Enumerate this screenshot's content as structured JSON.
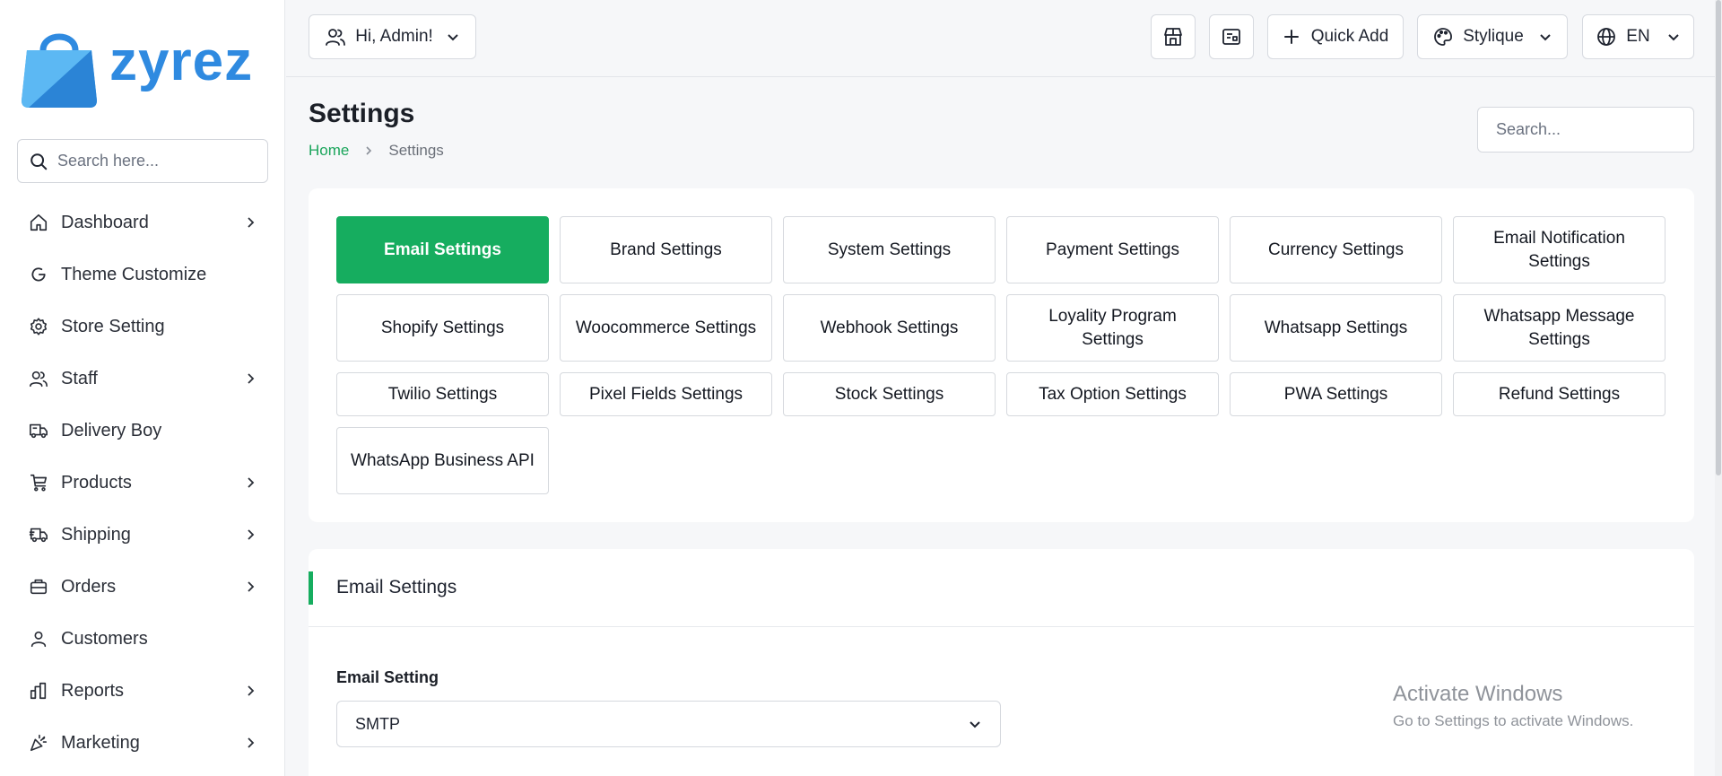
{
  "app": {
    "logo_text": "zyrez",
    "brand_color": "#2f8ae0",
    "accent_color": "#16ad5f"
  },
  "sidebar": {
    "search_placeholder": "Search here...",
    "items": [
      {
        "label": "Dashboard",
        "icon": "home-icon",
        "has_submenu": true
      },
      {
        "label": "Theme Customize",
        "icon": "theme-icon",
        "has_submenu": false
      },
      {
        "label": "Store Setting",
        "icon": "gear-icon",
        "has_submenu": false
      },
      {
        "label": "Staff",
        "icon": "users-icon",
        "has_submenu": true
      },
      {
        "label": "Delivery Boy",
        "icon": "truck-icon",
        "has_submenu": false
      },
      {
        "label": "Products",
        "icon": "cart-icon",
        "has_submenu": true
      },
      {
        "label": "Shipping",
        "icon": "shipping-truck-icon",
        "has_submenu": true
      },
      {
        "label": "Orders",
        "icon": "briefcase-icon",
        "has_submenu": true
      },
      {
        "label": "Customers",
        "icon": "user-icon",
        "has_submenu": false
      },
      {
        "label": "Reports",
        "icon": "bar-chart-icon",
        "has_submenu": true
      },
      {
        "label": "Marketing",
        "icon": "confetti-icon",
        "has_submenu": true
      }
    ]
  },
  "topbar": {
    "user_greeting": "Hi, Admin!",
    "quick_add": "Quick Add",
    "theme_name": "Stylique",
    "language": "EN"
  },
  "page": {
    "title": "Settings",
    "breadcrumb_home": "Home",
    "breadcrumb_current": "Settings",
    "search_placeholder": "Search..."
  },
  "settings_tabs": [
    [
      "Email Settings",
      "Brand Settings",
      "System Settings",
      "Payment Settings",
      "Currency Settings",
      "Email Notification Settings"
    ],
    [
      "Shopify Settings",
      "Woocommerce Settings",
      "Webhook Settings",
      "Loyality Program Settings",
      "Whatsapp Settings",
      "Whatsapp Message Settings"
    ],
    [
      "Twilio Settings",
      "Pixel Fields Settings",
      "Stock Settings",
      "Tax Option Settings",
      "PWA Settings",
      "Refund Settings"
    ],
    [
      "WhatsApp Business API"
    ]
  ],
  "active_tab": "Email Settings",
  "email_section": {
    "title": "Email Settings",
    "field_label": "Email Setting",
    "selected_value": "SMTP"
  },
  "watermark": {
    "line1": "Activate Windows",
    "line2": "Go to Settings to activate Windows."
  }
}
